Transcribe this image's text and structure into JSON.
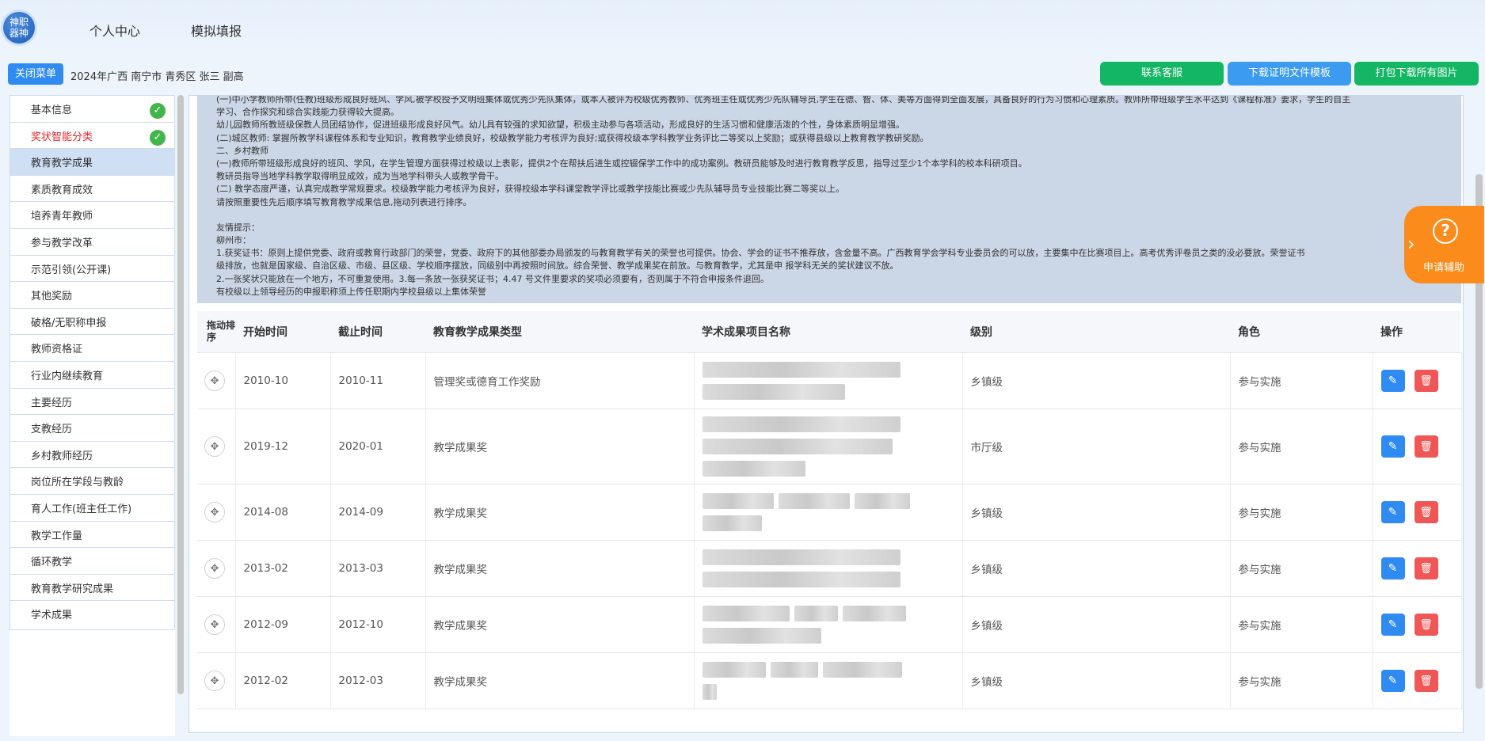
{
  "header": {
    "logo_text": "神职器神",
    "nav": [
      "个人中心",
      "模拟填报"
    ]
  },
  "subbar": {
    "close_menu": "关闭菜单",
    "breadcrumb": "2024年广西 南宁市 青秀区 张三 副高",
    "contact": "联系客服",
    "download_template": "下载证明文件模板",
    "download_all": "打包下载所有图片",
    "colors": {
      "contact": "#13b662",
      "download_template": "#3b9bf0",
      "download_all": "#13b662"
    }
  },
  "sidebar": {
    "items": [
      {
        "label": "基本信息",
        "done": true
      },
      {
        "label": "奖状智能分类",
        "done": true,
        "highlight": "red"
      },
      {
        "label": "教育教学成果",
        "active": true
      },
      {
        "label": "素质教育成效"
      },
      {
        "label": "培养青年教师"
      },
      {
        "label": "参与教学改革"
      },
      {
        "label": "示范引领(公开课)"
      },
      {
        "label": "其他奖励"
      },
      {
        "label": "破格/无职称申报"
      },
      {
        "label": "教师资格证"
      },
      {
        "label": "行业内继续教育"
      },
      {
        "label": "主要经历"
      },
      {
        "label": "支教经历"
      },
      {
        "label": "乡村教师经历"
      },
      {
        "label": "岗位所在学段与教龄"
      },
      {
        "label": "育人工作(班主任工作)"
      },
      {
        "label": "教学工作量"
      },
      {
        "label": "循环教学"
      },
      {
        "label": "教育教学研究成果"
      },
      {
        "label": "学术成果"
      }
    ]
  },
  "notice": {
    "lines": [
      "(一)中小学教师所带(任教)班级形成良好班风、学风,被学校授予文明班集体或优秀少先队集体，或本人被评为校级优秀教师、优秀班主任或优秀少先队辅导员,学生在德、智、体、美等方面得到全面发展，具备良好的行为习惯和心理素质。教师所带班级学生水平达到《课程标准》要求，学生的自主",
      "学习、合作探究和综合实践能力获得较大提高。",
      "幼儿园教师所教班级保教人员团结协作，促进班级形成良好风气。幼儿具有较强的求知欲望，积极主动参与各项活动，形成良好的生活习惯和健康活泼的个性，身体素质明显增强。",
      "(二)城区教师: 掌握所教学科课程体系和专业知识，教育教学业绩良好，校级教学能力考核评为良好;或获得校级本学科教学业务评比二等奖以上奖励；或获得县级以上教育教学教研奖励。",
      "二、乡村教师",
      "(一)教师所带班级形成良好的班风、学风，在学生管理方面获得过校级以上表彰，提供2个在帮扶后进生或控辍保学工作中的成功案例。教研员能够及时进行教育教学反思，指导过至少1个本学科的校本科研项目。",
      "教研员指导当地学科教学取得明显成效，成为当地学科带头人或教学骨干。",
      "(二) 教学态度严谨，认真完成教学常规要求。校级教学能力考核评为良好，获得校级本学科课堂教学评比或教学技能比赛或少先队辅导员专业技能比赛二等奖以上。",
      "请按照重要性先后顺序填写教育教学成果信息,拖动列表进行排序。",
      "",
      "友情提示：",
      "柳州市：",
      "1.获奖证书：原则上提供党委、政府或教育行政部门的荣誉，党委、政府下的其他部委办局颁发的与教育教学有关的荣誉也可提供。协会、学会的证书不推荐放，含金量不高。广西教育学会学科专业委员会的可以放，主要集中在比赛项目上。高考优秀评卷员之类的没必要放。荣誉证书",
      "级排放，也就是国家级、自治区级、市级、县区级、学校顺序摆放，同级别中再按照时间放。综合荣誉、教学成果奖在前放。与教育教学，尤其是申 报学科无关的奖状建议不放。",
      "2.一张奖状只能放在一个地方，不可重复使用。3.每一条放一张获奖证书；4.47 号文件里要求的奖项必须要有，否则属于不符合申报条件退回。",
      "有校级以上领导经历的申报职称须上传任职期内学校县级以上集体荣誉"
    ]
  },
  "table": {
    "headers": [
      "拖动排序",
      "开始时间",
      "截止时间",
      "教育教学成果类型",
      "学术成果项目名称",
      "级别",
      "角色",
      "操作"
    ],
    "rows": [
      {
        "start": "2010-10",
        "end": "2010-11",
        "type": "管理奖或德育工作奖励",
        "level": "乡镇级",
        "role": "参与实施"
      },
      {
        "start": "2019-12",
        "end": "2020-01",
        "type": "教学成果奖",
        "level": "市厅级",
        "role": "参与实施"
      },
      {
        "start": "2014-08",
        "end": "2014-09",
        "type": "教学成果奖",
        "level": "乡镇级",
        "role": "参与实施"
      },
      {
        "start": "2013-02",
        "end": "2013-03",
        "type": "教学成果奖",
        "level": "乡镇级",
        "role": "参与实施"
      },
      {
        "start": "2012-09",
        "end": "2012-10",
        "type": "教学成果奖",
        "level": "乡镇级",
        "role": "参与实施"
      },
      {
        "start": "2012-02",
        "end": "2012-03",
        "type": "教学成果奖",
        "level": "乡镇级",
        "role": "参与实施"
      }
    ]
  },
  "help": {
    "label": "申请辅助",
    "color": "#fb8b1a"
  },
  "icons": {
    "drag": "move-icon",
    "edit": "pencil-icon",
    "delete": "trash-icon",
    "check": "check-icon",
    "help": "question-icon"
  }
}
